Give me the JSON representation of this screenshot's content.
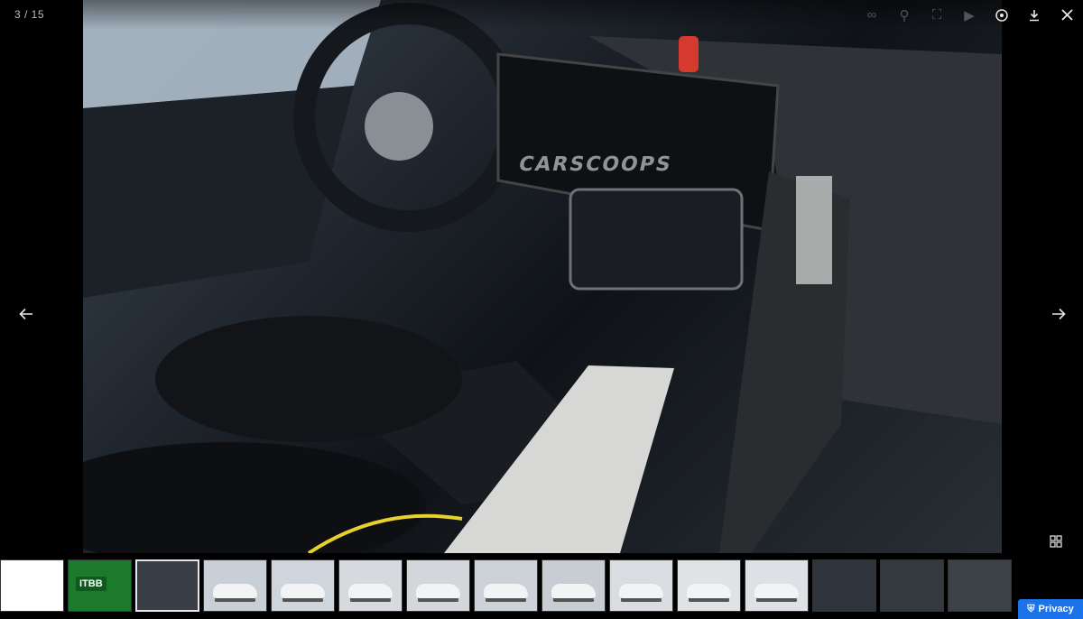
{
  "viewer": {
    "counter": "3 / 15",
    "watermark": "CARSCOOPS",
    "privacy_label": "Privacy"
  },
  "toolbar_icons": [
    "share-icon",
    "zoom-icon",
    "fullscreen-icon",
    "slideshow-icon",
    "info-icon",
    "download-icon",
    "close-icon"
  ],
  "thumbnails": [
    {
      "name": "thumb-blank",
      "color": "#ffffff"
    },
    {
      "name": "thumb-ad",
      "color": "#1b7a2c",
      "label": "ITBB"
    },
    {
      "name": "thumb-interior-1",
      "color": "#3a3f47",
      "active": true
    },
    {
      "name": "thumb-car-white-1",
      "color": "#c9cfd6"
    },
    {
      "name": "thumb-car-white-2",
      "color": "#cfd5dc"
    },
    {
      "name": "thumb-car-white-3",
      "color": "#d6d9de"
    },
    {
      "name": "thumb-car-white-4",
      "color": "#d3d6da"
    },
    {
      "name": "thumb-car-white-5",
      "color": "#cdd2d8"
    },
    {
      "name": "thumb-car-white-6",
      "color": "#c8cdd3"
    },
    {
      "name": "thumb-car-white-7",
      "color": "#d9dde2"
    },
    {
      "name": "thumb-car-white-8",
      "color": "#e0e3e6"
    },
    {
      "name": "thumb-car-white-9",
      "color": "#dde0e4"
    },
    {
      "name": "thumb-interior-2",
      "color": "#2e343b"
    },
    {
      "name": "thumb-interior-3",
      "color": "#343940"
    },
    {
      "name": "thumb-interior-4",
      "color": "#3d4249"
    }
  ]
}
